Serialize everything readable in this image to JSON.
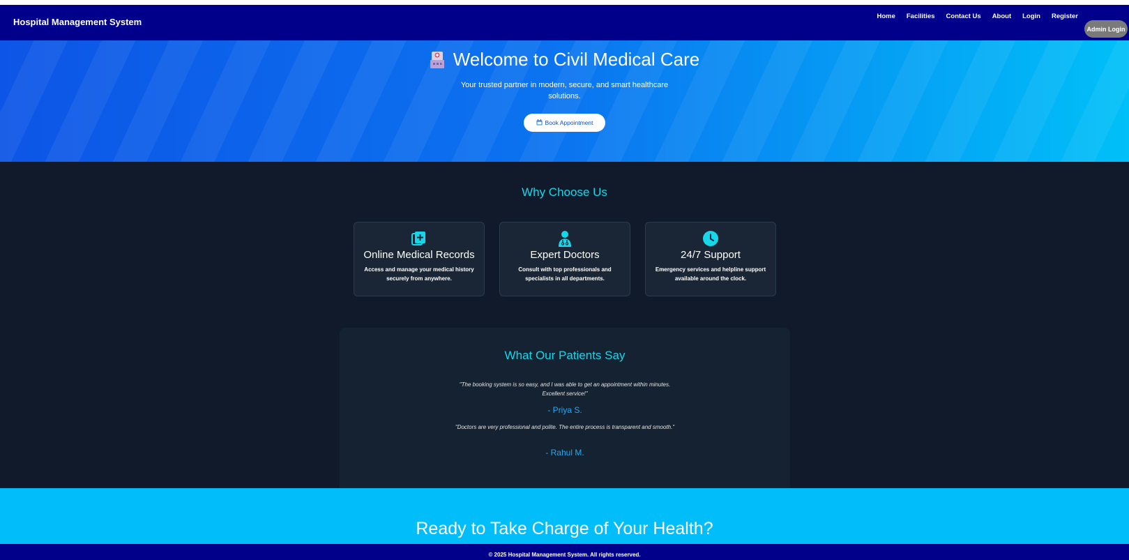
{
  "navbar": {
    "brand": "Hospital Management System",
    "links": [
      "Home",
      "Facilities",
      "Contact Us",
      "About",
      "Login",
      "Register"
    ],
    "admin_button": "Admin Login"
  },
  "hero": {
    "icon": "hospital-icon",
    "title": "Welcome to Civil Medical Care",
    "subtitle": "Your trusted partner in modern, secure, and smart healthcare solutions.",
    "button_icon": "calendar-icon",
    "button_label": "Book Appointment"
  },
  "why_choose_us": {
    "title": "Why Choose Us",
    "cards": [
      {
        "icon": "medical-records-icon",
        "title": "Online Medical Records",
        "description": "Access and manage your medical history securely from anywhere."
      },
      {
        "icon": "doctor-icon",
        "title": "Expert Doctors",
        "description": "Consult with top professionals and specialists in all departments."
      },
      {
        "icon": "clock-icon",
        "title": "24/7 Support",
        "description": "Emergency services and helpline support available around the clock."
      }
    ]
  },
  "testimonials": {
    "title": "What Our Patients Say",
    "items": [
      {
        "quote": "\"The booking system is so easy, and I was able to get an appointment within minutes. Excellent service!\"",
        "author": "- Priya S."
      },
      {
        "quote": "\"Doctors are very professional and polite. The entire process is transparent and smooth.\"",
        "author": "- Rahul M."
      }
    ]
  },
  "cta": {
    "title": "Ready to Take Charge of Your Health?"
  },
  "footer": {
    "text": "© 2025 Hospital Management System. All rights reserved."
  },
  "colors": {
    "navbar": "#00008b",
    "accent_cyan": "#16d6ea",
    "dark_bg": "#111a2a",
    "cta_bg": "#01bdfa"
  }
}
